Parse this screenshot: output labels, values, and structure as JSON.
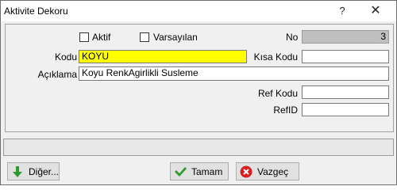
{
  "window": {
    "title": "Aktivite Dekoru",
    "help": "?",
    "close": "✕"
  },
  "form": {
    "aktif_label": "Aktif",
    "aktif_checked": false,
    "varsayilan_label": "Varsayılan",
    "varsayilan_checked": false,
    "no_label": "No",
    "no_value": "3",
    "kodu_label": "Kodu",
    "kodu_value": "KOYU",
    "kisa_kodu_label": "Kısa Kodu",
    "kisa_kodu_value": "",
    "aciklama_label": "Açıklama",
    "aciklama_value": "Koyu RenkAgirlikli Susleme",
    "ref_kodu_label": "Ref Kodu",
    "ref_kodu_value": "",
    "refid_label": "RefID",
    "refid_value": ""
  },
  "status": {
    "text": ""
  },
  "buttons": {
    "diger": "Diğer...",
    "tamam": "Tamam",
    "vazgec": "Vazgeç"
  },
  "colors": {
    "kodu_bg": "#ffff00",
    "ok_icon": "#2e9b2e",
    "cancel_icon": "#d81e1e",
    "down_icon": "#2e9b2e"
  },
  "icons": {
    "diger": "arrow-down-icon",
    "tamam": "checkmark-icon",
    "vazgec": "cancel-icon"
  }
}
